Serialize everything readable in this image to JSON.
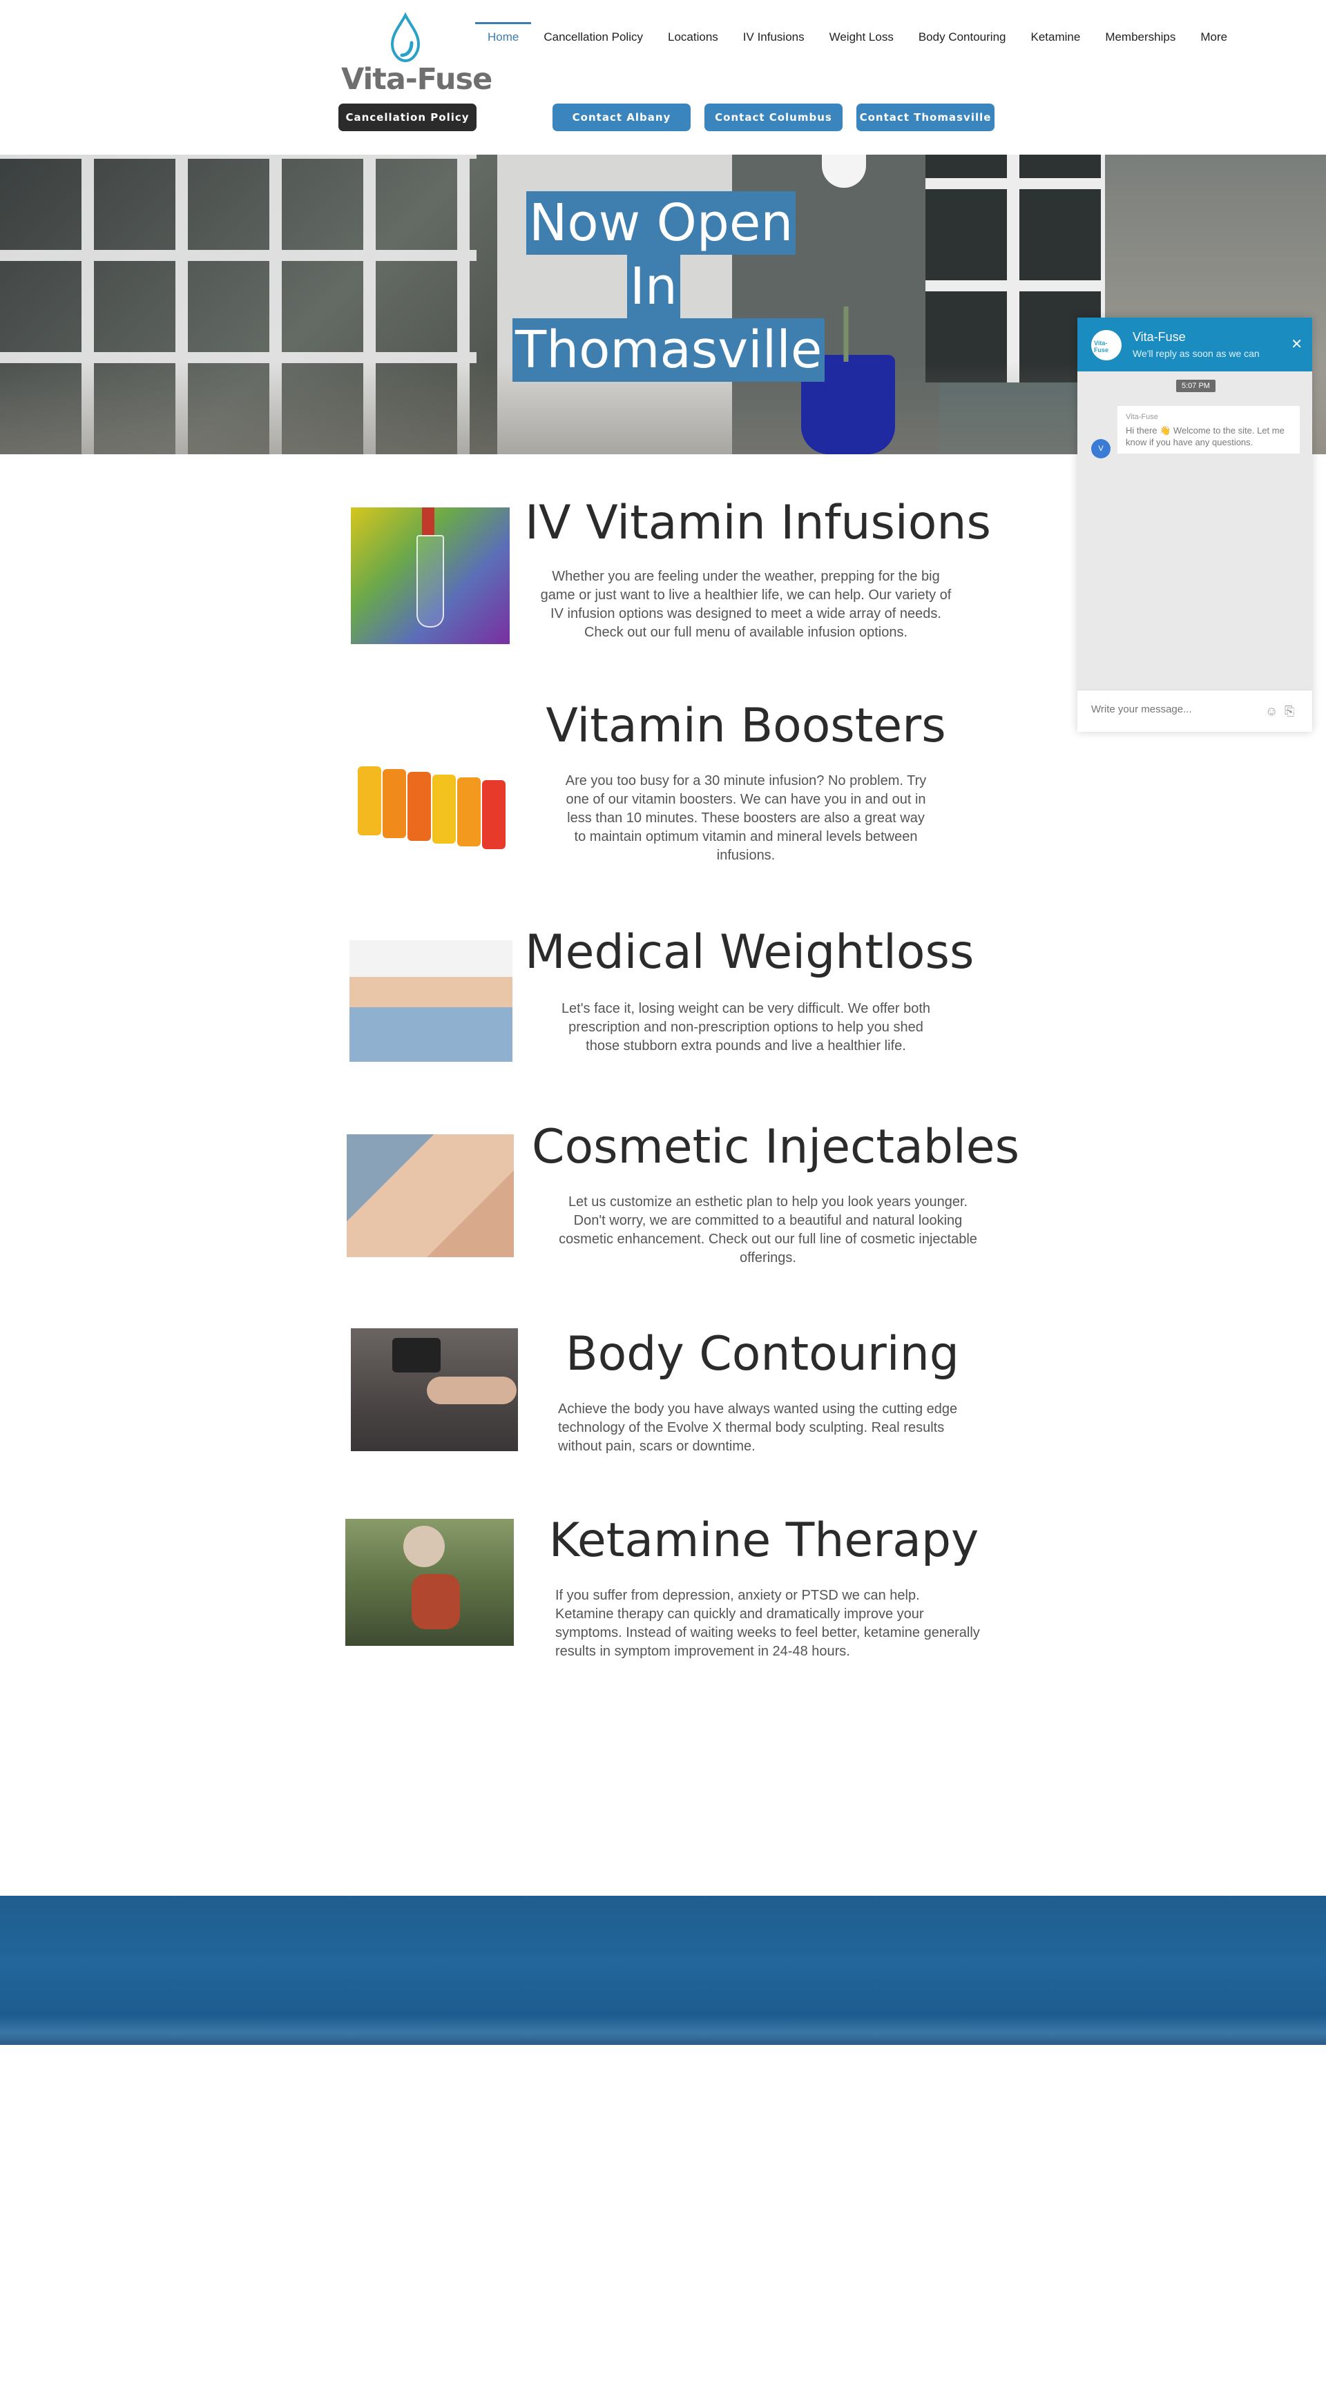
{
  "brand": {
    "name": "Vita-Fuse",
    "accent": "#3a85bd",
    "dark": "#2b2b2b"
  },
  "nav": {
    "items": [
      {
        "label": "Home",
        "active": true
      },
      {
        "label": "Cancellation Policy"
      },
      {
        "label": "Locations"
      },
      {
        "label": "IV Infusions"
      },
      {
        "label": "Weight Loss"
      },
      {
        "label": "Body Contouring"
      },
      {
        "label": "Ketamine"
      },
      {
        "label": "Memberships"
      },
      {
        "label": "More"
      }
    ]
  },
  "buttons": {
    "cancellation": "Cancellation Policy",
    "albany": "Contact Albany",
    "columbus": "Contact Columbus",
    "thomasville": "Contact Thomasville"
  },
  "hero": {
    "line1": "Now Open",
    "line2": "In",
    "line3": "Thomasville"
  },
  "services": [
    {
      "title": "IV Vitamin Infusions",
      "image": "iv-drip-image",
      "description": "Whether you are feeling under the weather, prepping for the big game or just want to live a healthier life, we can help.  Our variety of IV infusion options was designed to meet a wide array of needs.  Check out our full menu of available infusion options."
    },
    {
      "title": "Vitamin Boosters",
      "image": "vitamin-vials-image",
      "description": "Are you too busy for a 30 minute infusion? No problem. Try one of our vitamin boosters.  We can have you in and out in less than 10 minutes.  These boosters are also a great way to maintain optimum vitamin and mineral levels between infusions."
    },
    {
      "title": "Medical Weightloss",
      "image": "weightloss-image",
      "description": "Let's face it, losing weight can be very difficult.  We offer both prescription and non-prescription options to help you shed those stubborn extra pounds and live a healthier life."
    },
    {
      "title": "Cosmetic Injectables",
      "image": "injectables-image",
      "description": "Let us customize an esthetic plan to help you look years younger. Don't worry, we are committed to a beautiful and natural looking cosmetic enhancement. Check out our full line of cosmetic injectable offerings."
    },
    {
      "title": "Body Contouring",
      "image": "body-contouring-image",
      "description": "Achieve the body you have always wanted using the cutting edge technology of the Evolve X thermal body sculpting.  Real results without pain, scars or downtime."
    },
    {
      "title": "Ketamine Therapy",
      "image": "ketamine-image",
      "description": "If you suffer from depression, anxiety or PTSD we can help.  Ketamine therapy can quickly and dramatically improve your symptoms.  Instead of waiting weeks to feel better, ketamine generally results in symptom improvement in 24-48 hours."
    }
  ],
  "chat": {
    "name": "Vita-Fuse",
    "subtitle": "We'll reply as soon as we can",
    "time": "5:07 PM",
    "sender": "Vita-Fuse",
    "message": "Hi there 👋 Welcome to the site. Let me know if you have any questions.",
    "bot_initial": "V",
    "avatar_text": "Vita-Fuse",
    "placeholder": "Write your message...",
    "header_color": "#1b8cc0"
  }
}
